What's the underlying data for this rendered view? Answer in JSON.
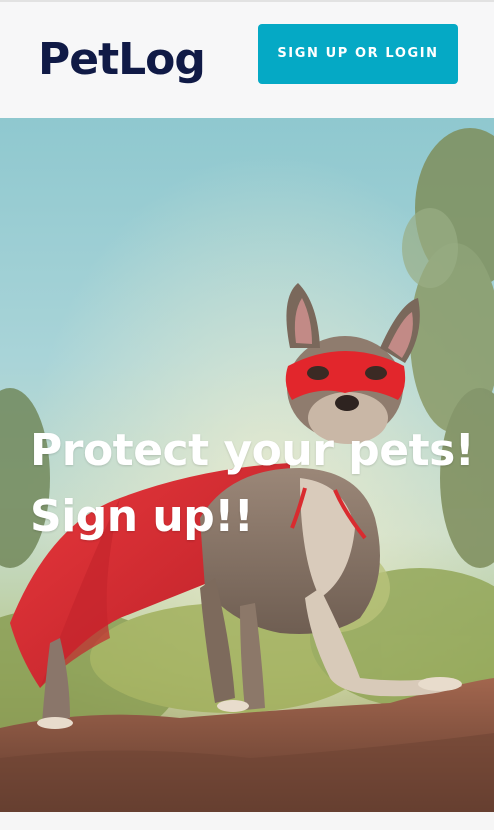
{
  "header": {
    "logo": "PetLog",
    "cta_label": "SIGN UP OR LOGIN"
  },
  "hero": {
    "headline_line1": "Protect your pets!",
    "headline_line2": "Sign up!!",
    "image_subject": "french-bulldog-superhero-photo"
  },
  "colors": {
    "brand_navy": "#101a46",
    "cta_teal": "#05a9c5",
    "cape_red": "#d92b2f"
  }
}
